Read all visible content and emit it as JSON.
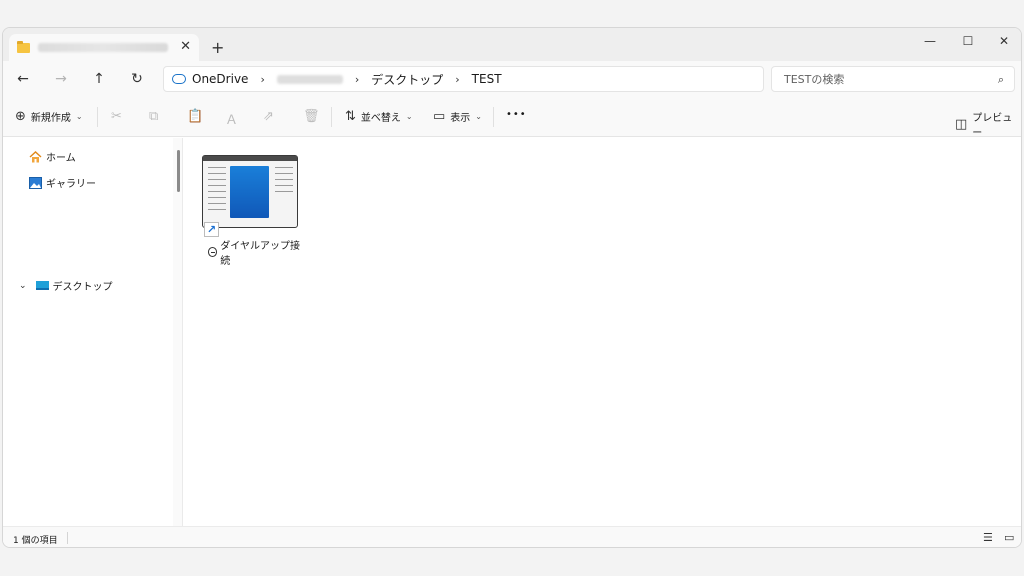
{
  "tab": {
    "title": "",
    "close_glyph": "✕",
    "new_glyph": "+"
  },
  "window_controls": {
    "minimize": "—",
    "maximize": "☐",
    "close": "✕"
  },
  "nav": {
    "back": "←",
    "forward": "→",
    "up": "↑",
    "refresh": "↻"
  },
  "address": {
    "crumbs": [
      "OneDrive",
      "デスクトップ",
      "TEST"
    ],
    "separator": "›",
    "icon": "onedrive-cloud-icon"
  },
  "search": {
    "placeholder": "TESTの検索",
    "icon_glyph": "⌕"
  },
  "toolbar": {
    "new_label": "新規作成",
    "new_icon": "⊕",
    "sort_label": "並べ替え",
    "sort_icon": "⇅",
    "view_label": "表示",
    "view_icon": "▭",
    "more_label": "•••",
    "preview_label": "プレビュー",
    "preview_icon": "◫",
    "chevron": "⌄",
    "cut_icon": "✂",
    "copy_icon": "⧉",
    "paste_icon": "📋",
    "rename_icon": "Ａ",
    "share_icon": "⇗",
    "delete_icon": "🗑"
  },
  "sidebar": {
    "items": [
      {
        "label": "ホーム",
        "icon": "home-icon"
      },
      {
        "label": "ギャラリー",
        "icon": "gallery-icon"
      },
      {
        "label": "デスクトップ",
        "icon": "desktop-icon",
        "expand": "⌄"
      }
    ]
  },
  "content": {
    "files": [
      {
        "name": "ダイヤルアップ接続",
        "icon": "shortcut-icon",
        "shortcut_glyph": "↗"
      }
    ]
  },
  "statusbar": {
    "count_text": "1 個の項目",
    "details_view_glyph": "☰",
    "tiles_view_glyph": "▭"
  },
  "colors": {
    "accent": "#1a73c9",
    "folder": "#f6c441",
    "panel": "#1a7fd9"
  }
}
